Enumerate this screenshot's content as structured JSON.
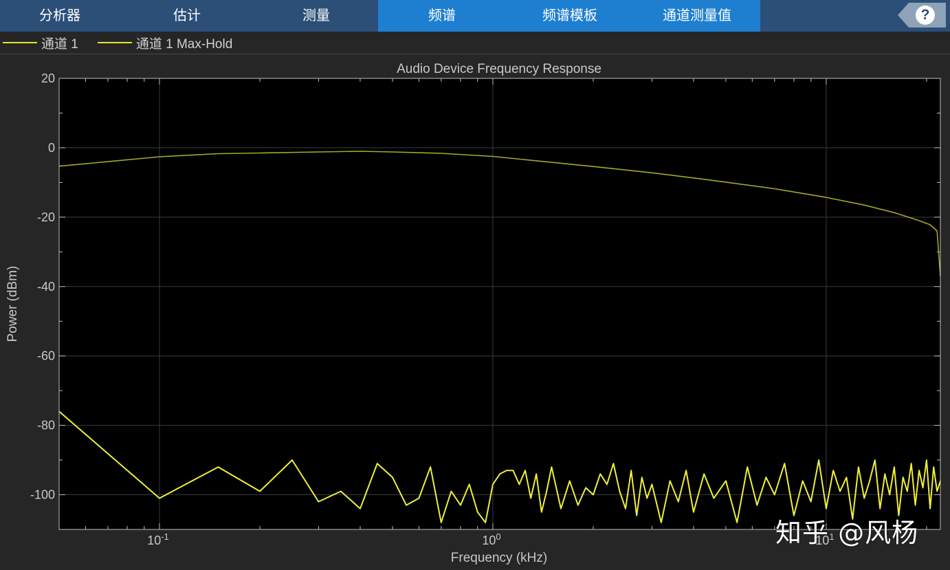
{
  "toolbar": {
    "tabs": [
      {
        "label": "分析器"
      },
      {
        "label": "估计"
      },
      {
        "label": "测量"
      },
      {
        "label": "频谱"
      },
      {
        "label": "频谱模板"
      },
      {
        "label": "通道测量值"
      }
    ],
    "help_label": "?"
  },
  "legend": {
    "items": [
      {
        "label": "通道 1",
        "color": "#e6e62a"
      },
      {
        "label": "通道 1 Max-Hold",
        "color": "#e6e62a"
      }
    ]
  },
  "colors": {
    "toolbar_bg": "#2c4f78",
    "toolbar_active_bg": "#1e7fd0",
    "axes_bg": "#000000",
    "trace": "#f0f03a",
    "trace_dim": "#a8a82a",
    "grid": "#3c3c3c"
  },
  "chart_data": {
    "type": "line",
    "title": "Audio Device Frequency Response",
    "xlabel": "Frequency (kHz)",
    "ylabel": "Power (dBm)",
    "xscale": "log",
    "xlim": [
      0.05,
      22
    ],
    "ylim": [
      -110,
      20
    ],
    "yticks": [
      20,
      0,
      -20,
      -40,
      -60,
      -80,
      -100
    ],
    "xticks": [
      {
        "value": 0.1,
        "base": "10",
        "exp": "-1"
      },
      {
        "value": 1,
        "base": "10",
        "exp": "0"
      },
      {
        "value": 10,
        "base": "10",
        "exp": "1"
      }
    ],
    "grid": true,
    "series": [
      {
        "name": "通道 1 Max-Hold",
        "x": [
          0.05,
          0.07,
          0.1,
          0.15,
          0.2,
          0.3,
          0.4,
          0.5,
          0.7,
          1.0,
          1.5,
          2.0,
          3.0,
          4.0,
          5.0,
          7.0,
          10.0,
          13.0,
          16.0,
          19.0,
          20.5,
          21.5,
          22.0
        ],
        "y": [
          -5.3,
          -4.0,
          -2.6,
          -1.7,
          -1.5,
          -1.2,
          -1.0,
          -1.2,
          -1.6,
          -2.5,
          -4.2,
          -5.4,
          -7.2,
          -8.7,
          -9.9,
          -11.8,
          -14.3,
          -16.5,
          -18.7,
          -21.0,
          -22.2,
          -24.0,
          -37.0
        ]
      },
      {
        "name": "通道 1",
        "x": [
          0.05,
          0.1,
          0.15,
          0.2,
          0.25,
          0.3,
          0.35,
          0.4,
          0.45,
          0.5,
          0.55,
          0.6,
          0.65,
          0.7,
          0.75,
          0.8,
          0.85,
          0.9,
          0.95,
          1.0,
          1.05,
          1.1,
          1.15,
          1.2,
          1.25,
          1.3,
          1.35,
          1.4,
          1.45,
          1.5,
          1.6,
          1.7,
          1.8,
          1.9,
          2.0,
          2.1,
          2.2,
          2.3,
          2.4,
          2.5,
          2.6,
          2.7,
          2.8,
          2.9,
          3.0,
          3.2,
          3.4,
          3.6,
          3.8,
          4.0,
          4.3,
          4.6,
          5.0,
          5.4,
          5.8,
          6.2,
          6.6,
          7.0,
          7.5,
          8.0,
          8.5,
          9.0,
          9.5,
          10.0,
          10.5,
          11.0,
          11.5,
          12.0,
          12.5,
          13.0,
          13.5,
          14.0,
          14.5,
          15.0,
          15.5,
          16.0,
          16.5,
          17.0,
          17.5,
          18.0,
          18.5,
          19.0,
          19.5,
          20.0,
          20.5,
          21.0,
          21.5,
          22.0
        ],
        "y": [
          -76,
          -101,
          -92,
          -99,
          -90,
          -102,
          -99,
          -104,
          -91,
          -95,
          -103,
          -101,
          -92,
          -108,
          -99,
          -103,
          -97,
          -105,
          -108,
          -97,
          -94,
          -93,
          -93,
          -97,
          -93,
          -101,
          -94,
          -105,
          -99,
          -92,
          -104,
          -96,
          -103,
          -98,
          -100,
          -94,
          -97,
          -91,
          -99,
          -104,
          -93,
          -106,
          -95,
          -101,
          -97,
          -108,
          -96,
          -102,
          -93,
          -105,
          -94,
          -101,
          -96,
          -108,
          -92,
          -103,
          -95,
          -100,
          -91,
          -106,
          -96,
          -102,
          -90,
          -104,
          -93,
          -99,
          -95,
          -107,
          -92,
          -101,
          -96,
          -90,
          -104,
          -94,
          -100,
          -92,
          -106,
          -95,
          -99,
          -91,
          -103,
          -93,
          -98,
          -90,
          -104,
          -92,
          -99,
          -96
        ]
      }
    ]
  },
  "watermark": "知乎 @风杨"
}
